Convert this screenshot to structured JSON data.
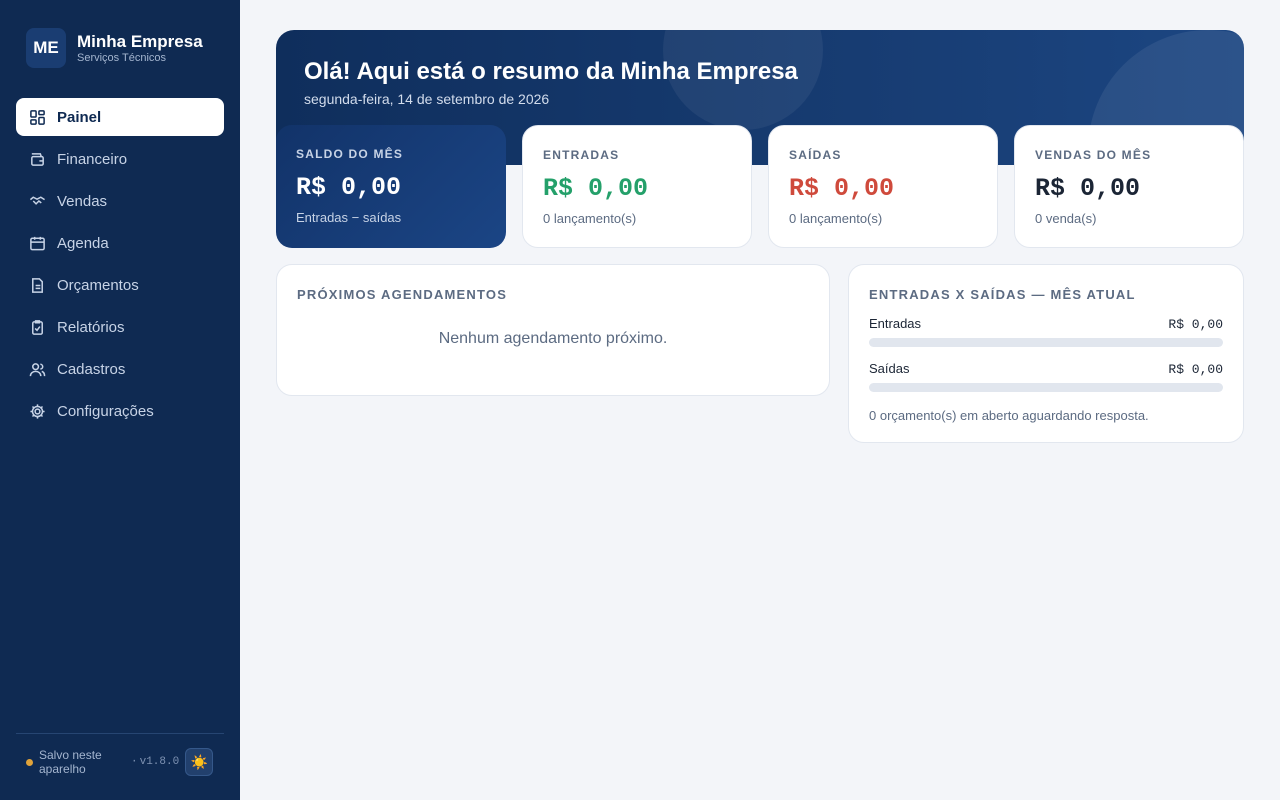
{
  "brand": {
    "logo": "ME",
    "name": "Minha Empresa",
    "subtitle": "Serviços Técnicos"
  },
  "nav": [
    {
      "label": "Painel",
      "icon": "dashboard-icon",
      "active": true
    },
    {
      "label": "Financeiro",
      "icon": "wallet-icon",
      "active": false
    },
    {
      "label": "Vendas",
      "icon": "handshake-icon",
      "active": false
    },
    {
      "label": "Agenda",
      "icon": "calendar-icon",
      "active": false
    },
    {
      "label": "Orçamentos",
      "icon": "document-icon",
      "active": false
    },
    {
      "label": "Relatórios",
      "icon": "report-icon",
      "active": false
    },
    {
      "label": "Cadastros",
      "icon": "users-icon",
      "active": false
    },
    {
      "label": "Configurações",
      "icon": "gear-icon",
      "active": false
    }
  ],
  "footer": {
    "status": "Salvo neste aparelho",
    "separator": "·",
    "version": "v1.8.0",
    "theme_icon": "☀️"
  },
  "hero": {
    "title": "Olá! Aqui está o resumo da Minha Empresa",
    "date": "segunda-feira, 14 de setembro de 2026"
  },
  "stats": [
    {
      "label": "SALDO DO MÊS",
      "value": "R$ 0,00",
      "sub": "Entradas − saídas"
    },
    {
      "label": "ENTRADAS",
      "value": "R$ 0,00",
      "sub": "0 lançamento(s)"
    },
    {
      "label": "SAÍDAS",
      "value": "R$ 0,00",
      "sub": "0 lançamento(s)"
    },
    {
      "label": "VENDAS DO MÊS",
      "value": "R$ 0,00",
      "sub": "0 venda(s)"
    }
  ],
  "schedule": {
    "title": "PRÓXIMOS AGENDAMENTOS",
    "empty": "Nenhum agendamento próximo."
  },
  "flow": {
    "title": "ENTRADAS X SAÍDAS — MÊS ATUAL",
    "rows": [
      {
        "label": "Entradas",
        "amount": "R$ 0,00",
        "fraction": 0
      },
      {
        "label": "Saídas",
        "amount": "R$ 0,00",
        "fraction": 0
      }
    ],
    "note": "0 orçamento(s) em aberto aguardando resposta."
  },
  "colors": {
    "sidebar": "#0f2a52",
    "positive": "#24a06a",
    "negative": "#cf4a3c",
    "accent": "#1b4585"
  }
}
